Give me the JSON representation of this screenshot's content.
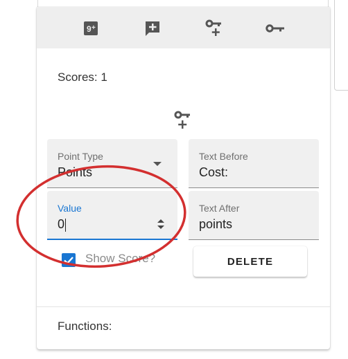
{
  "toolbar": {
    "icons": [
      "nine-plus-icon",
      "add-comment-icon",
      "add-key-icon",
      "key-icon"
    ]
  },
  "scores": {
    "label": "Scores: 1"
  },
  "center_icon": "add-key-icon",
  "fields": {
    "point_type": {
      "label": "Point Type",
      "value": "Points"
    },
    "text_before": {
      "label": "Text Before",
      "value": "Cost:"
    },
    "value": {
      "label": "Value",
      "value": "0"
    },
    "text_after": {
      "label": "Text After",
      "value": "points"
    }
  },
  "show_score": {
    "label": "Show Score?",
    "checked": true
  },
  "delete_button": {
    "label": "DELETE"
  },
  "functions": {
    "label": "Functions:"
  },
  "colors": {
    "accent": "#1976d2",
    "annotation": "#d32f2f",
    "toolbar_bg": "#eeeeee",
    "field_bg": "#f0f0f0"
  }
}
